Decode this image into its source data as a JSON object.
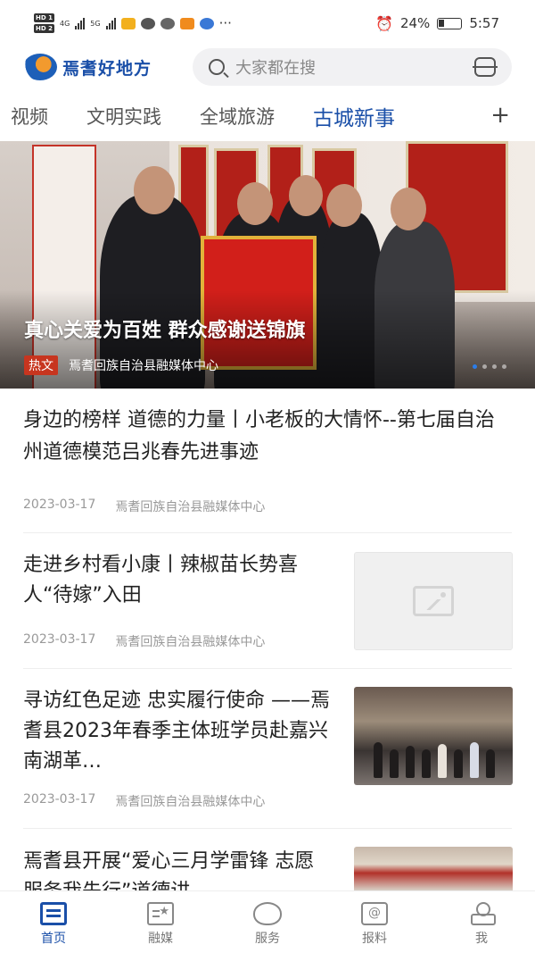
{
  "statusbar": {
    "hd1": "HD 1",
    "hd2": "HD 2",
    "net1": "4G",
    "net2": "5G",
    "more": "···",
    "battery": "24%",
    "time": "5:57"
  },
  "header": {
    "logo_text": "焉耆好地方",
    "search_placeholder": "大家都在搜"
  },
  "tabs": [
    {
      "label": "视频"
    },
    {
      "label": "文明实践"
    },
    {
      "label": "全域旅游"
    },
    {
      "label": "古城新事"
    }
  ],
  "tab_add": "+",
  "hero": {
    "title": "真心关爱为百姓 群众感谢送锦旗",
    "badge": "热文",
    "source": "焉耆回族自治县融媒体中心"
  },
  "feed": [
    {
      "title": "身边的榜样 道德的力量丨小老板的大情怀--第七届自治州道德模范吕兆春先进事迹",
      "date": "2023-03-17",
      "source": "焉耆回族自治县融媒体中心"
    },
    {
      "title": "走进乡村看小康丨辣椒苗长势喜人“待嫁”入田",
      "date": "2023-03-17",
      "source": "焉耆回族自治县融媒体中心"
    },
    {
      "title": "寻访红色足迹 忠实履行使命 ——焉耆县2023年春季主体班学员赴嘉兴南湖革…",
      "date": "2023-03-17",
      "source": "焉耆回族自治县融媒体中心"
    },
    {
      "title": "焉耆县开展“爱心三月学雷锋 志愿服务我先行”道德讲"
    }
  ],
  "bottomnav": [
    {
      "label": "首页",
      "icon": "home-icon"
    },
    {
      "label": "融媒",
      "icon": "media-icon"
    },
    {
      "label": "服务",
      "icon": "service-icon"
    },
    {
      "label": "报料",
      "icon": "report-icon"
    },
    {
      "label": "我",
      "icon": "profile-icon"
    }
  ],
  "colors": {
    "accent": "#1a4fa8",
    "badge": "#c7351f"
  }
}
